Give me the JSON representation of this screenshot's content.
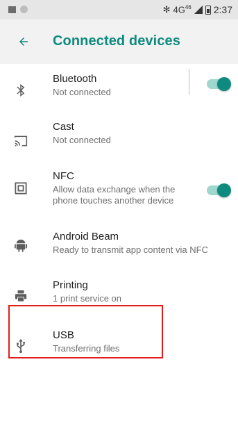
{
  "status_bar": {
    "bluetooth_icon": "bluetooth-icon",
    "network": "4G",
    "network_superscript": "46",
    "time": "2:37"
  },
  "app_bar": {
    "back_icon": "arrow-left-icon",
    "title": "Connected devices"
  },
  "items": [
    {
      "icon": "bluetooth-icon",
      "name": "Bluetooth",
      "subtitle": "Not connected",
      "toggle": true
    },
    {
      "icon": "cast-icon",
      "name": "Cast",
      "subtitle": "Not connected"
    },
    {
      "icon": "nfc-icon",
      "name": "NFC",
      "subtitle": "Allow data exchange when the\nphone touches another device",
      "toggle": true
    },
    {
      "icon": "android-icon",
      "name": "Android Beam",
      "subtitle": "Ready to transmit app content via NFC"
    },
    {
      "icon": "printer-icon",
      "name": "Printing",
      "subtitle": "1 print service on"
    },
    {
      "icon": "usb-icon",
      "name": "USB",
      "subtitle": "Transferring files"
    }
  ],
  "colors": {
    "accent": "#0f8a7e",
    "highlight": "#e21b1b"
  }
}
